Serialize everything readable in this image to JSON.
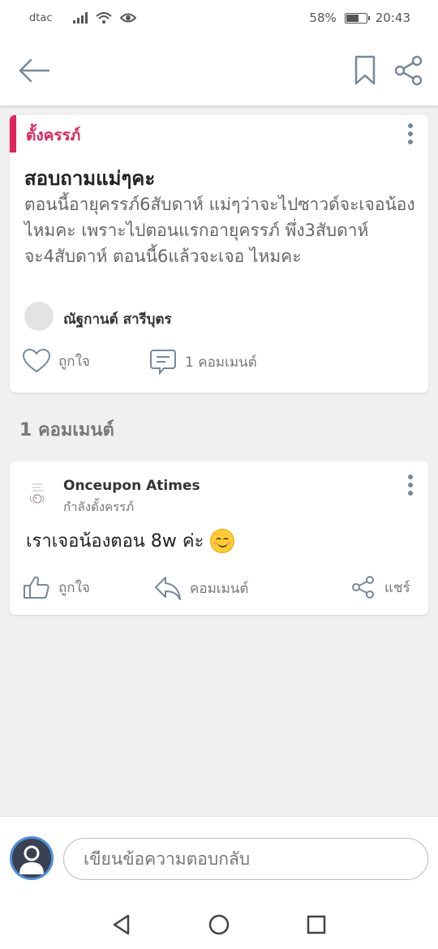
{
  "status_bar": {
    "carrier": "dtac",
    "battery": "58%",
    "battery_level": 0.58,
    "time": "20:43"
  },
  "post": {
    "category": "ตั้งครรภ์",
    "title": "สอบถามแม่ๆคะ",
    "body": "ตอนนี้อายุครรภ์6สับดาห์ แม่ๆว่าจะไปซาวด์จะเจอน้องไหมคะ เพราะไปตอนแรกอายุครรภ์ พึ่ง3สับดาห์จะ4สับดาห์ ตอนนี้6แล้วจะเจอ ไหมคะ",
    "author": "ณัฐกานต์ สารีบุตร",
    "like_label": "ถูกใจ",
    "comment_count_label": "1 คอมเมนต์"
  },
  "comments_heading": "1 คอมเมนต์",
  "comment": {
    "author": "Onceupon Atimes",
    "status": "กำลังตั้งครรภ์",
    "text": "เราเจอน้องตอน 8w ค่ะ",
    "like_label": "ถูกใจ",
    "reply_label": "คอมเมนต์",
    "share_label": "แชร์"
  },
  "compose": {
    "placeholder": "เขียนข้อความตอบกลับ"
  },
  "colors": {
    "accent": "#e0245e",
    "icon": "#778899"
  }
}
